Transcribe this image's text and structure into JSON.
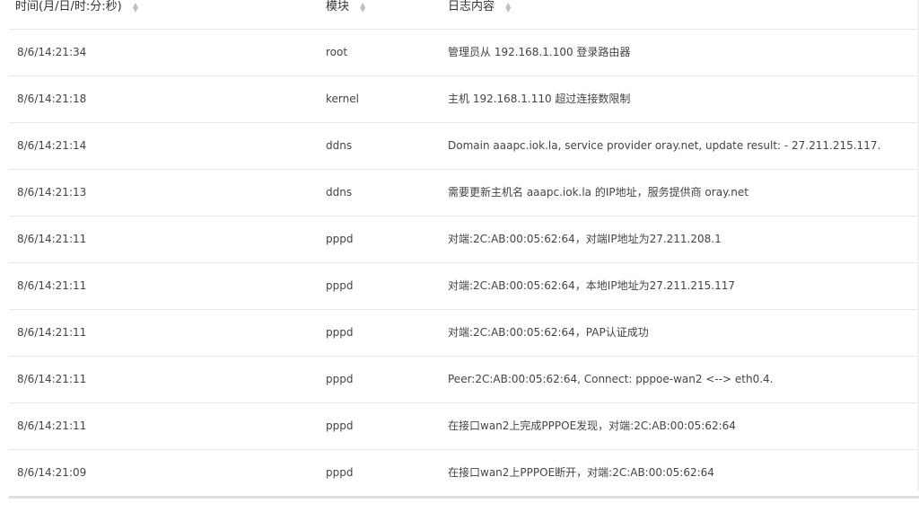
{
  "table": {
    "headers": {
      "time": "时间(月/日/时:分:秒)",
      "module": "模块",
      "content": "日志内容"
    },
    "rows": [
      {
        "time": "8/6/14:21:34",
        "module": "root",
        "content": "管理员从 192.168.1.100 登录路由器"
      },
      {
        "time": "8/6/14:21:18",
        "module": "kernel",
        "content": "主机 192.168.1.110 超过连接数限制"
      },
      {
        "time": "8/6/14:21:14",
        "module": "ddns",
        "content": "Domain aaapc.iok.la, service provider oray.net, update result: - 27.211.215.117."
      },
      {
        "time": "8/6/14:21:13",
        "module": "ddns",
        "content": "需要更新主机名 aaapc.iok.la 的IP地址，服务提供商 oray.net"
      },
      {
        "time": "8/6/14:21:11",
        "module": "pppd",
        "content": "对端:2C:AB:00:05:62:64，对端IP地址为27.211.208.1"
      },
      {
        "time": "8/6/14:21:11",
        "module": "pppd",
        "content": "对端:2C:AB:00:05:62:64，本地IP地址为27.211.215.117"
      },
      {
        "time": "8/6/14:21:11",
        "module": "pppd",
        "content": "对端:2C:AB:00:05:62:64，PAP认证成功"
      },
      {
        "time": "8/6/14:21:11",
        "module": "pppd",
        "content": "Peer:2C:AB:00:05:62:64, Connect: pppoe-wan2 <--> eth0.4."
      },
      {
        "time": "8/6/14:21:11",
        "module": "pppd",
        "content": "在接口wan2上完成PPPOE发现，对端:2C:AB:00:05:62:64"
      },
      {
        "time": "8/6/14:21:09",
        "module": "pppd",
        "content": "在接口wan2上PPPOE断开，对端:2C:AB:00:05:62:64"
      }
    ]
  },
  "icons": {
    "sort": "sort-icon"
  }
}
